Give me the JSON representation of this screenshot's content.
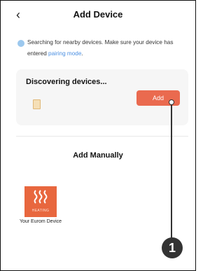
{
  "header": {
    "back_icon": "‹",
    "title": "Add Device"
  },
  "search": {
    "message_part1": "Searching for nearby devices. Make sure your device has entered ",
    "link_text": "pairing mode",
    "message_end": "."
  },
  "discover": {
    "title": "Discovering devices...",
    "add_label": "Add"
  },
  "manual": {
    "title": "Add Manually",
    "tile": {
      "image_text": "HEATING",
      "label": "Your Eurom Device"
    }
  },
  "annotation": {
    "number": "1"
  },
  "colors": {
    "accent": "#ea6a4f",
    "tile": "#e8673e",
    "link": "#4a8fe2"
  }
}
